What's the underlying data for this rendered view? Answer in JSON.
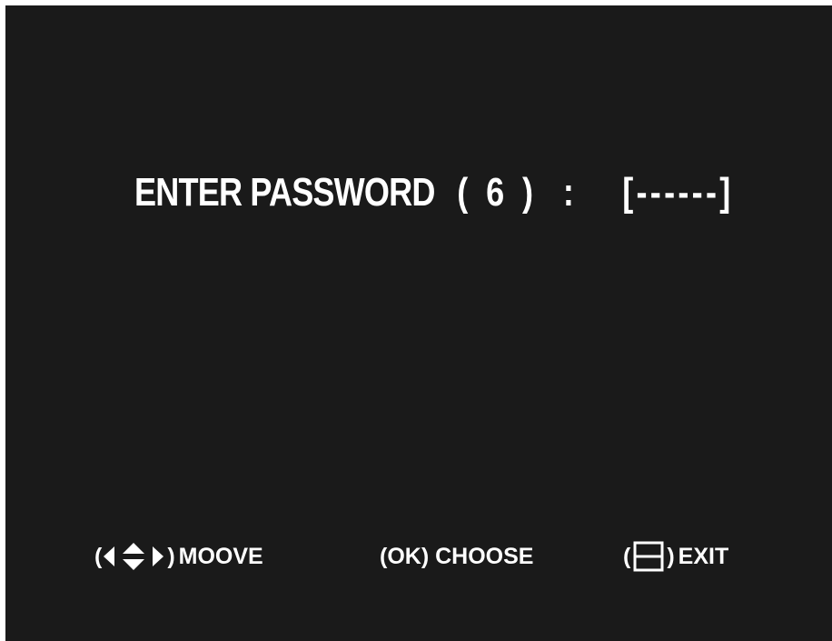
{
  "password_prompt": {
    "label": "ENTER PASSWORD",
    "digits": "( 6 )",
    "colon": ":",
    "field": "[------]"
  },
  "footer": {
    "move": {
      "open_paren": "(",
      "close_paren": ")",
      "label": "MOOVE",
      "icon": "arrows-icon"
    },
    "choose": {
      "label": "(OK) CHOOSE"
    },
    "exit": {
      "open_paren": "(",
      "close_paren": ")",
      "label": "EXIT",
      "icon": "menu-icon"
    }
  },
  "colors": {
    "background": "#1a1a1a",
    "text": "#ffffff"
  }
}
